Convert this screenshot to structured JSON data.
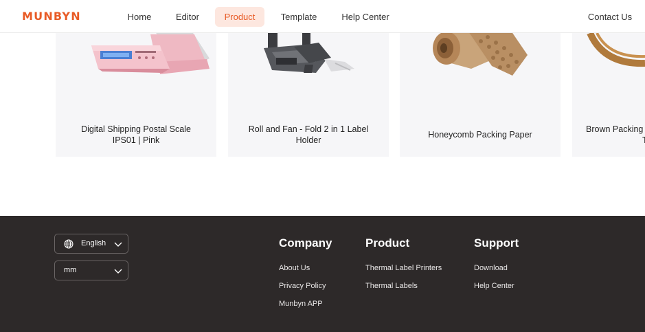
{
  "header": {
    "logo": "MUNBYN",
    "nav": [
      {
        "label": "Home"
      },
      {
        "label": "Editor"
      },
      {
        "label": "Product"
      },
      {
        "label": "Template"
      },
      {
        "label": "Help Center"
      }
    ],
    "contact": "Contact Us",
    "accent": "#e85b26"
  },
  "products": [
    {
      "line1": "Digital Shipping Postal Scale",
      "line2": "IPS01 | Pink"
    },
    {
      "line1": "Roll and Fan - Fold 2 in 1 Label",
      "line2": "Holder"
    },
    {
      "line1": "Honeycomb Packing Paper",
      "line2": ""
    },
    {
      "line1": "Brown Packing",
      "line2": "T"
    }
  ],
  "footer": {
    "language": "English",
    "unit": "mm",
    "columns": [
      {
        "title": "Company",
        "links": [
          "About Us",
          "Privacy Policy",
          "Munbyn APP"
        ]
      },
      {
        "title": "Product",
        "links": [
          "Thermal Label Printers",
          "Thermal Labels"
        ]
      },
      {
        "title": "Support",
        "links": [
          "Download",
          "Help Center"
        ]
      }
    ],
    "background": "#2d2929"
  }
}
